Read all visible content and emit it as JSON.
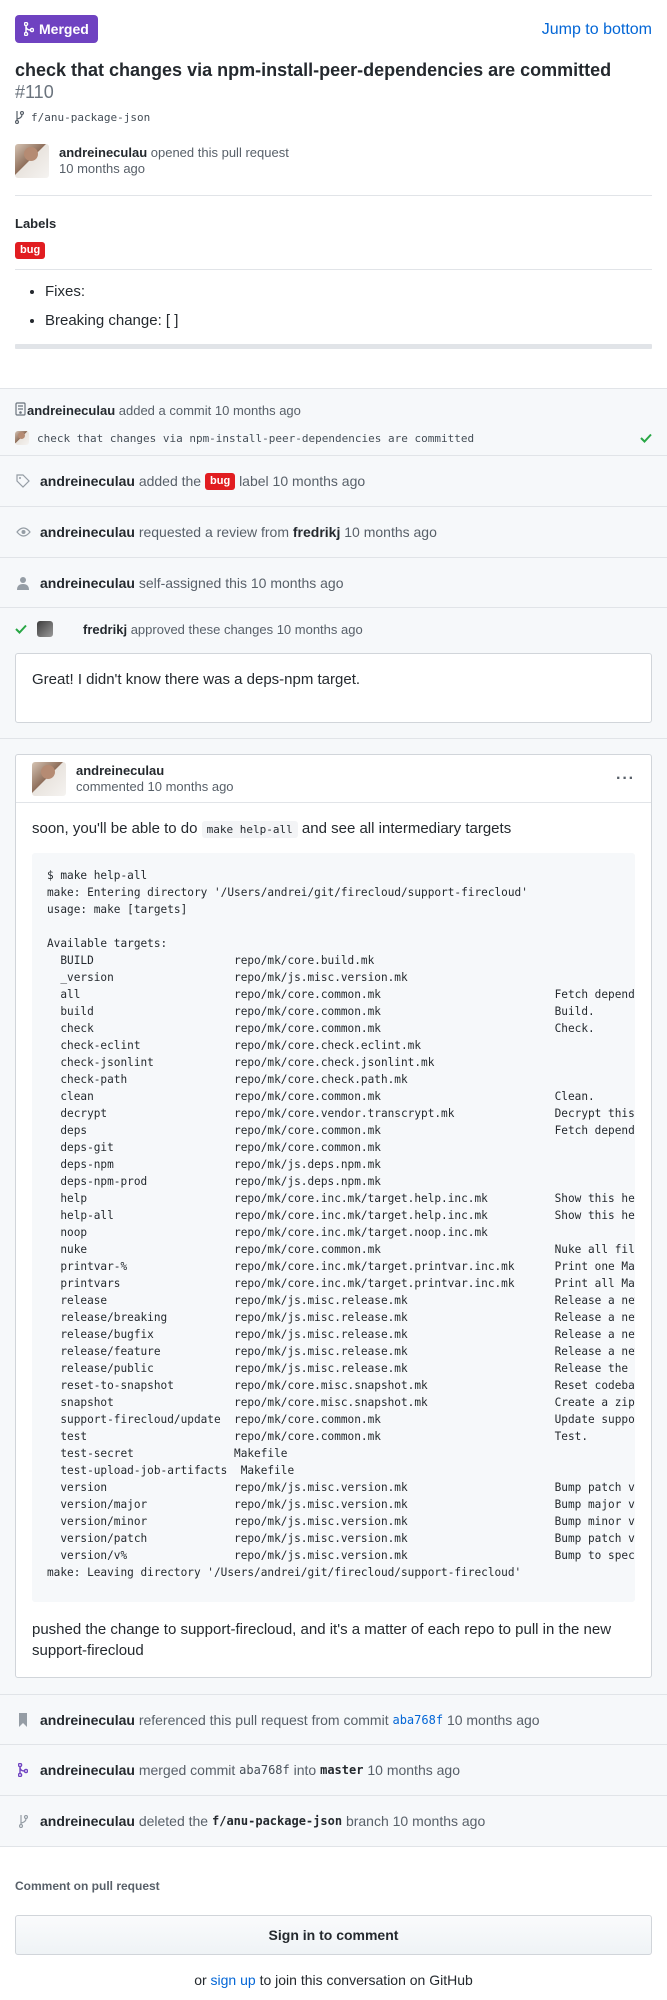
{
  "header": {
    "status": "Merged",
    "jump": "Jump to bottom",
    "title": "check that changes via npm-install-peer-dependencies are committed",
    "number": "#110",
    "branch": "f/anu-package-json",
    "author": "andreineculau",
    "opened": "opened this pull request",
    "time": "10 months ago"
  },
  "labels": {
    "heading": "Labels",
    "items": [
      "bug"
    ]
  },
  "body": {
    "items": [
      "Fixes:",
      "Breaking change: [ ]"
    ]
  },
  "timeline": {
    "commit": {
      "user": "andreineculau",
      "text": "added a commit",
      "time": "10 months ago",
      "message": "check that changes via npm-install-peer-dependencies are committed"
    },
    "label_event": {
      "user": "andreineculau",
      "pre": "added the",
      "label": "bug",
      "post": "label 10 months ago"
    },
    "review_request": {
      "user": "andreineculau",
      "text": "requested a review from",
      "reviewer": "fredrikj",
      "time": "10 months ago"
    },
    "assign": {
      "user": "andreineculau",
      "text": "self-assigned this 10 months ago"
    },
    "review": {
      "user": "fredrikj",
      "text": "approved these changes 10 months ago",
      "comment": "Great! I didn't know there was a deps-npm target."
    },
    "comment": {
      "user": "andreineculau",
      "time": "commented 10 months ago",
      "menu": "···",
      "intro_pre": "soon, you'll be able to do",
      "intro_code": "make help-all",
      "intro_post": "and see all intermediary targets",
      "code": "$ make help-all\nmake: Entering directory '/Users/andrei/git/firecloud/support-firecloud'\nusage: make [targets]\n\nAvailable targets:\n  BUILD                     repo/mk/core.build.mk\n  _version                  repo/mk/js.misc.version.mk\n  all                       repo/mk/core.common.mk                          Fetch dependencies\n  build                     repo/mk/core.common.mk                          Build.\n  check                     repo/mk/core.common.mk                          Check.\n  check-eclint              repo/mk/core.check.eclint.mk\n  check-jsonlint            repo/mk/core.check.jsonlint.mk\n  check-path                repo/mk/core.check.path.mk\n  clean                     repo/mk/core.common.mk                          Clean.\n  decrypt                   repo/mk/core.vendor.transcrypt.mk               Decrypt this repo\n  deps                      repo/mk/core.common.mk                          Fetch dependencies\n  deps-git                  repo/mk/core.common.mk\n  deps-npm                  repo/mk/js.deps.npm.mk\n  deps-npm-prod             repo/mk/js.deps.npm.mk\n  help                      repo/mk/core.inc.mk/target.help.inc.mk          Show this help me\n  help-all                  repo/mk/core.inc.mk/target.help.inc.mk          Show this help me\n  noop                      repo/mk/core.inc.mk/target.noop.inc.mk\n  nuke                      repo/mk/core.common.mk                          Nuke all files/ch\n  printvar-%                repo/mk/core.inc.mk/target.printvar.inc.mk      Print one Makefil\n  printvars                 repo/mk/core.inc.mk/target.printvar.inc.mk      Print all Makefil\n  release                   repo/mk/js.misc.release.mk                      Release a new pat\n  release/breaking          repo/mk/js.misc.release.mk                      Release a new sem\n  release/bugfix            repo/mk/js.misc.release.mk                      Release a new sem\n  release/feature           repo/mk/js.misc.release.mk                      Release a new sem\n  release/public            repo/mk/js.misc.release.mk                      Release the first\n  reset-to-snapshot         repo/mk/core.misc.snapshot.mk                   Reset codebase to\n  snapshot                  repo/mk/core.misc.snapshot.mk                   Create a zip snap\n  support-firecloud/update  repo/mk/core.common.mk                          Update support-fi\n  test                      repo/mk/core.common.mk                          Test.\n  test-secret               Makefile\n  test-upload-job-artifacts  Makefile\n  version                   repo/mk/js.misc.version.mk                      Bump patch versio\n  version/major             repo/mk/js.misc.version.mk                      Bump major versio\n  version/minor             repo/mk/js.misc.version.mk                      Bump minor versio\n  version/patch             repo/mk/js.misc.version.mk                      Bump patch versio\n  version/v%                repo/mk/js.misc.version.mk                      Bump to specific\nmake: Leaving directory '/Users/andrei/git/firecloud/support-firecloud'",
      "outro": "pushed the change to support-firecloud, and it's a matter of each repo to pull in the new support-firecloud"
    },
    "reference": {
      "user": "andreineculau",
      "text": "referenced this pull request from commit",
      "sha": "aba768f",
      "time": "10 months ago"
    },
    "merge": {
      "user": "andreineculau",
      "text": "merged commit",
      "sha": "aba768f",
      "into": "into",
      "branch": "master",
      "time": "10 months ago"
    },
    "delete": {
      "user": "andreineculau",
      "text": "deleted the",
      "branch": "f/anu-package-json",
      "post": "branch 10 months ago"
    }
  },
  "footer": {
    "title": "Comment on pull request",
    "signin": "Sign in to comment",
    "or": "or",
    "signup": "sign up",
    "rest": "to join this conversation on GitHub"
  },
  "colors": {
    "merged": "#6f42c1",
    "link": "#0366d6",
    "bug": "#e11d21",
    "approved": "#28a745"
  }
}
